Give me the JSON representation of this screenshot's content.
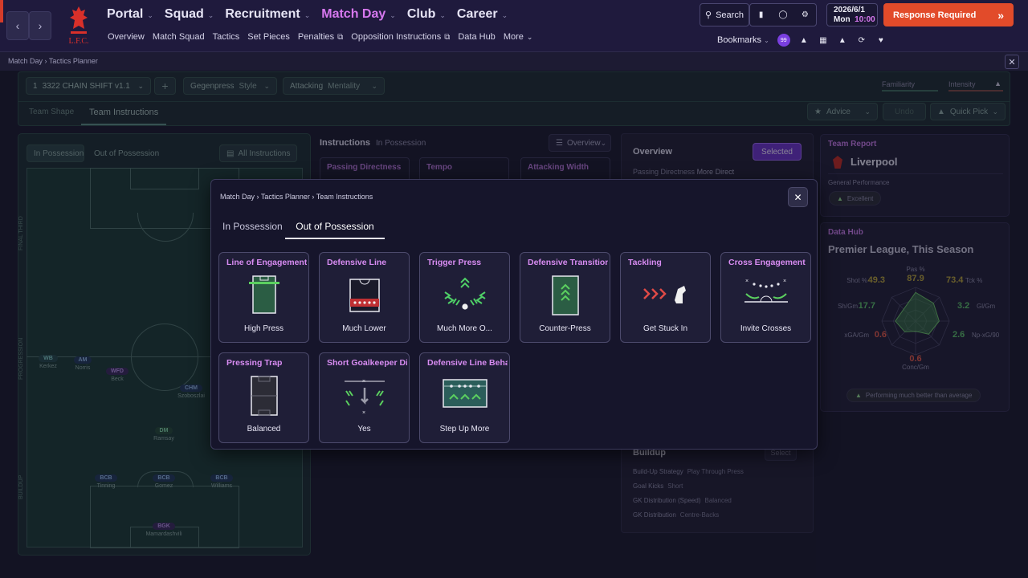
{
  "app": {
    "club_logo_text": "L.F.C."
  },
  "menu": [
    {
      "label": "Portal",
      "active": false
    },
    {
      "label": "Squad",
      "active": false
    },
    {
      "label": "Recruitment",
      "active": false
    },
    {
      "label": "Match Day",
      "active": true
    },
    {
      "label": "Club",
      "active": false
    },
    {
      "label": "Career",
      "active": false
    }
  ],
  "submenu": [
    "Overview",
    "Match Squad",
    "Tactics",
    "Set Pieces",
    "Penalties",
    "Opposition Instructions",
    "Data Hub",
    "More"
  ],
  "top": {
    "search": "Search",
    "date": "2026/6/1",
    "day": "Mon",
    "time": "10:00",
    "response": "Response Required",
    "bookmarks": "Bookmarks",
    "notification_badge": "99"
  },
  "breadcrumb": {
    "a": "Match Day",
    "b": "Tactics Planner"
  },
  "tactics": {
    "slot": "1",
    "name": "3322 CHAIN SHIFT v1.1",
    "style_value": "Gegenpress",
    "style_label": "Style",
    "mentality_value": "Attacking",
    "mentality_label": "Mentality",
    "familiarity": "Familiarity",
    "intensity": "Intensity",
    "tabs": [
      "Team Shape",
      "Team Instructions"
    ],
    "advice": "Advice",
    "undo": "Undo",
    "quick_pick": "Quick Pick"
  },
  "pitch": {
    "tabs": [
      "In Possession",
      "Out of Possession"
    ],
    "all_instructions": "All Instructions",
    "side_labels": [
      "FINAL THIRD",
      "PROGRESSION",
      "BUILDUP"
    ],
    "players": [
      {
        "role": "WB",
        "name": "Kerkez",
        "color": "teal"
      },
      {
        "role": "AM",
        "name": "Norris",
        "color": "blue"
      },
      {
        "role": "WFD",
        "name": "Beck",
        "color": "purple"
      },
      {
        "role": "CHM",
        "name": "Szoboszlai",
        "color": "blue"
      },
      {
        "role": "DM",
        "name": "Ramsay",
        "color": "green"
      },
      {
        "role": "BCB",
        "name": "Tinning",
        "color": "blue"
      },
      {
        "role": "BCB",
        "name": "Gomez",
        "color": "blue"
      },
      {
        "role": "BCB",
        "name": "Williams",
        "color": "blue"
      },
      {
        "role": "BGK",
        "name": "Mamardashvili",
        "color": "purple"
      }
    ]
  },
  "instructions": {
    "title": "Instructions",
    "sub": "In Possession",
    "view": "Overview",
    "cards": [
      "Passing Directness",
      "Tempo",
      "Attacking Width"
    ]
  },
  "overview": {
    "title": "Overview",
    "selected": "Selected",
    "row1_label": "Passing Directness",
    "row1_value": "More Direct",
    "buildup_title": "Buildup",
    "select": "Select",
    "rows": [
      {
        "label": "Build-Up Strategy",
        "value": "Play Through Press"
      },
      {
        "label": "Goal Kicks",
        "value": "Short"
      },
      {
        "label": "GK Distribution (Speed)",
        "value": "Balanced"
      },
      {
        "label": "GK Distribution",
        "value": "Centre-Backs"
      }
    ]
  },
  "team_report": {
    "title": "Team Report",
    "team": "Liverpool",
    "perf_label": "General Performance",
    "perf_value": "Excellent"
  },
  "data_hub": {
    "title": "Data Hub",
    "subtitle": "Premier League, This Season",
    "footer": "Performing much better than average",
    "axes": [
      {
        "label": "Pas %",
        "value": "87.9"
      },
      {
        "label": "Tck %",
        "value": "73.4"
      },
      {
        "label": "Gl/Gm",
        "value": "3.2"
      },
      {
        "label": "Np-xG/90",
        "value": "2.6"
      },
      {
        "label": "Conc/Gm",
        "value": "0.6"
      },
      {
        "label": "xGA/Gm",
        "value": "0.6"
      },
      {
        "label": "Sh/Gm",
        "value": "17.7"
      },
      {
        "label": "Shot %",
        "value": "49.3"
      }
    ],
    "levels": [
      0.85,
      0.75,
      0.7,
      0.55,
      0.3,
      0.45,
      0.6,
      0.5
    ]
  },
  "modal": {
    "crumb": [
      "Match Day",
      "Tactics Planner",
      "Team Instructions"
    ],
    "tabs": [
      "In Possession",
      "Out of Possession"
    ],
    "active_tab": 1,
    "cards": [
      {
        "title": "Line of Engagement",
        "value": "High Press",
        "icon": "line-of-engagement-icon"
      },
      {
        "title": "Defensive Line",
        "value": "Much Lower",
        "icon": "defensive-line-icon"
      },
      {
        "title": "Trigger Press",
        "value": "Much More O...",
        "icon": "trigger-press-icon"
      },
      {
        "title": "Defensive Transition",
        "value": "Counter-Press",
        "icon": "counter-press-icon"
      },
      {
        "title": "Tackling",
        "value": "Get Stuck In",
        "icon": "tackling-icon"
      },
      {
        "title": "Cross Engagement",
        "value": "Invite Crosses",
        "icon": "cross-engagement-icon"
      },
      {
        "title": "Pressing Trap",
        "value": "Balanced",
        "icon": "pressing-trap-icon"
      },
      {
        "title": "Short Goalkeeper Distri",
        "value": "Yes",
        "icon": "short-gk-distribution-icon"
      },
      {
        "title": "Defensive Line Behavic",
        "value": "Step Up More",
        "icon": "defensive-line-behaviour-icon"
      }
    ]
  },
  "colors": {
    "accent": "#d778ef",
    "response": "#e24b2a",
    "pitch": "#1d3b38",
    "selected": "#6b34c9",
    "green": "#5bd05f"
  }
}
